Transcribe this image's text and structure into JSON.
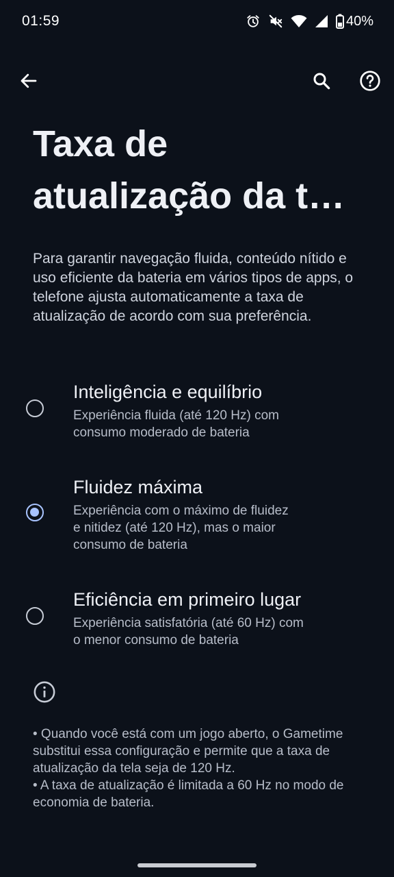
{
  "status_bar": {
    "time": "01:59",
    "battery_percent": "40%",
    "icons": [
      "alarm-icon",
      "mute-icon",
      "wifi-icon",
      "signal-icon",
      "battery-icon"
    ]
  },
  "top_bar": {
    "icons": [
      "back-arrow-icon",
      "search-icon",
      "help-icon"
    ]
  },
  "page": {
    "title": "Taxa de\natualização da t…",
    "intro": "Para garantir navegação fluida, conteúdo nítido e uso eficiente da bateria em vários tipos de apps, o telefone ajusta automaticamente a taxa de atualização de acordo com sua preferência."
  },
  "options": [
    {
      "title": "Inteligência e equilíbrio",
      "description": "Experiência fluida (até 120 Hz) com\nconsumo moderado de bateria",
      "selected": false
    },
    {
      "title": "Fluidez máxima",
      "description": "Experiência com o máximo de fluidez\ne nitidez (até 120 Hz), mas o maior\nconsumo de bateria",
      "selected": true
    },
    {
      "title": "Eficiência em primeiro lugar",
      "description": "Experiência satisfatória (até 60 Hz) com\no menor consumo de bateria",
      "selected": false
    }
  ],
  "footnotes": [
    "• Quando você está com um jogo aberto, o Gametime substitui essa configuração e permite que a taxa de atualização da tela seja de 120 Hz.",
    "• A taxa de atualização é limitada a 60 Hz no modo de economia de bateria."
  ],
  "colors": {
    "background": "#0c111a",
    "accent": "#a9c4ff",
    "text_primary": "#eef0f5",
    "text_secondary": "#b7bdc9"
  }
}
